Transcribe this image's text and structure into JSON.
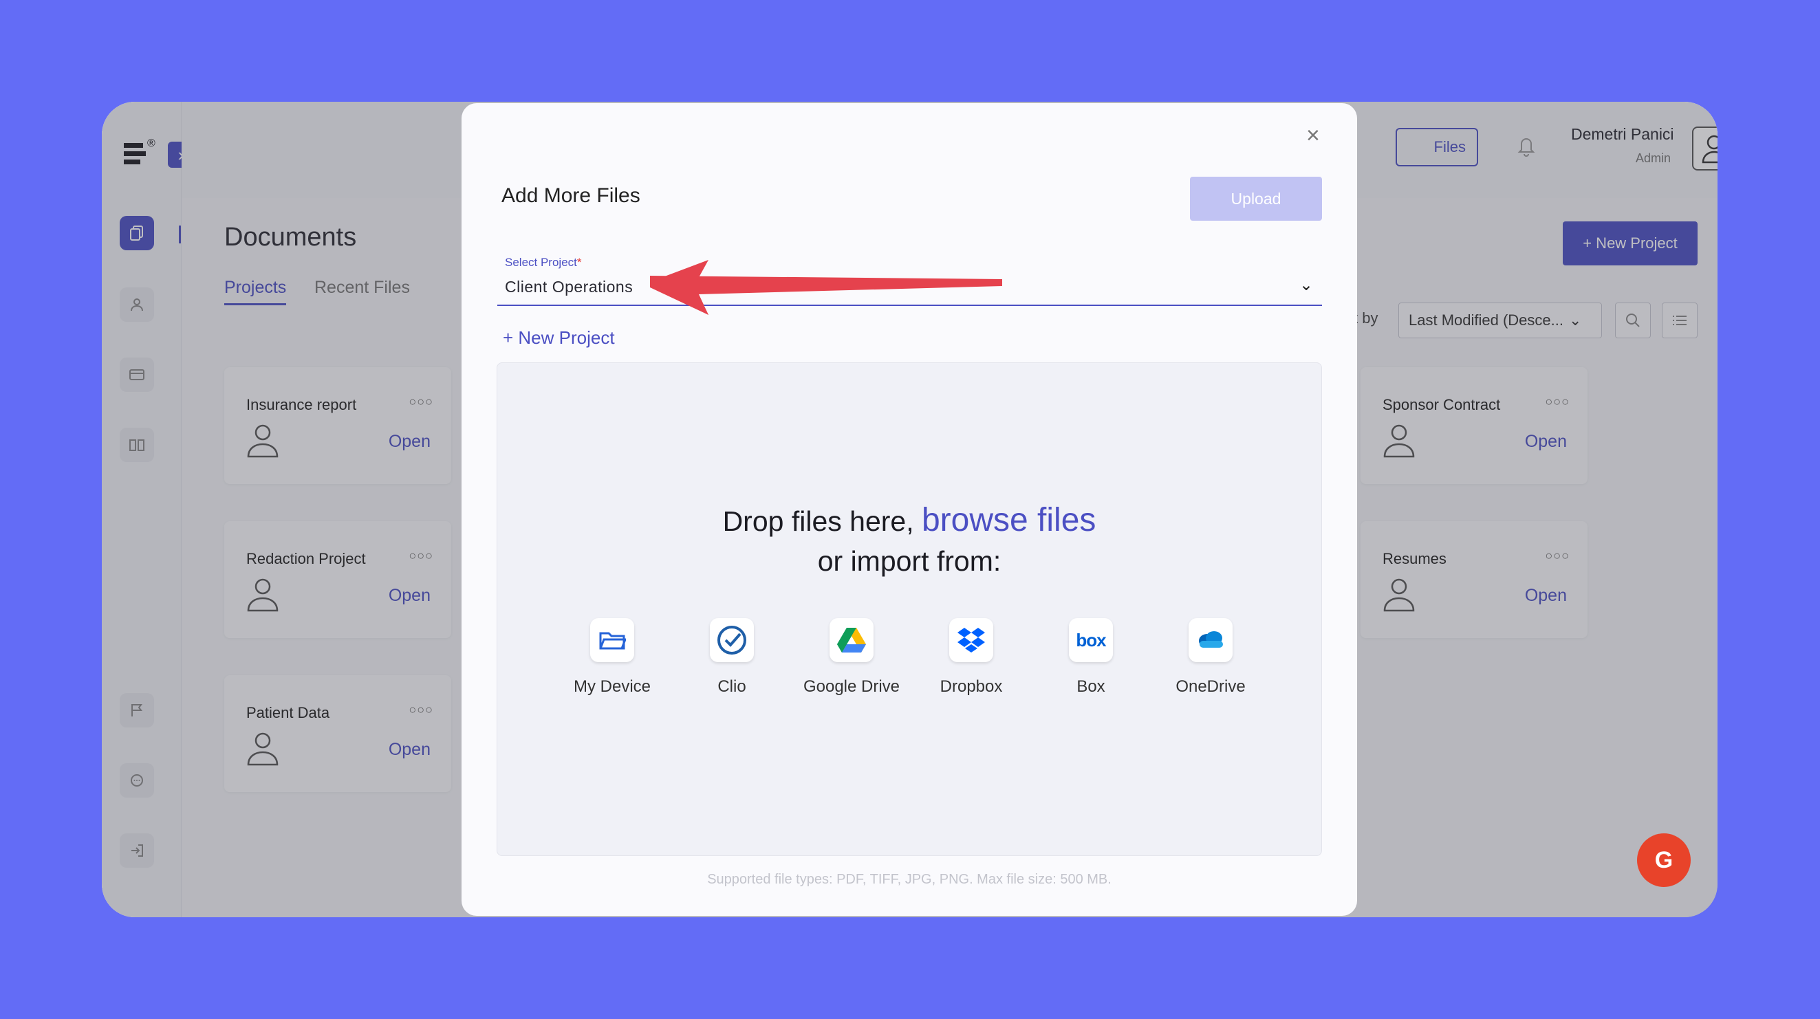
{
  "app": {
    "user": {
      "name": "Demetri Panici",
      "role": "Admin"
    },
    "header": {
      "files_label": "Files"
    },
    "page_title": "Documents",
    "tabs": [
      {
        "label": "Projects",
        "active": true
      },
      {
        "label": "Recent Files",
        "active": false
      }
    ],
    "new_project_label": "+ New Project",
    "sort": {
      "label": "t by",
      "value": "Last Modified (Desce..."
    },
    "projects": [
      {
        "name": "Insurance report",
        "action": "Open"
      },
      {
        "name": "Redaction Project",
        "action": "Open"
      },
      {
        "name": "Patient Data",
        "action": "Open"
      },
      {
        "name": "Sponsor Contract",
        "action": "Open"
      },
      {
        "name": "Resumes",
        "action": "Open"
      }
    ],
    "badge_text": "G"
  },
  "modal": {
    "close_icon": "×",
    "title": "Add More Files",
    "upload_label": "Upload",
    "select_label": "Select Project",
    "select_required": "*",
    "selected_project": "Client Operations",
    "new_project_link": "+ New Project",
    "drop_text_before": "Drop files here, ",
    "browse_link": "browse files",
    "drop_text_after": " or import from:",
    "sources": [
      {
        "label": "My Device",
        "icon": "folder-icon"
      },
      {
        "label": "Clio",
        "icon": "clio-icon"
      },
      {
        "label": "Google Drive",
        "icon": "google-drive-icon"
      },
      {
        "label": "Dropbox",
        "icon": "dropbox-icon"
      },
      {
        "label": "Box",
        "icon": "box-icon"
      },
      {
        "label": "OneDrive",
        "icon": "onedrive-icon"
      }
    ],
    "supported_text": "Supported file types: PDF, TIFF, JPG, PNG. Max file size: 500 MB."
  },
  "colors": {
    "background": "#636cf6",
    "accent": "#4b4fc3",
    "annotation_arrow": "#e5424d"
  }
}
